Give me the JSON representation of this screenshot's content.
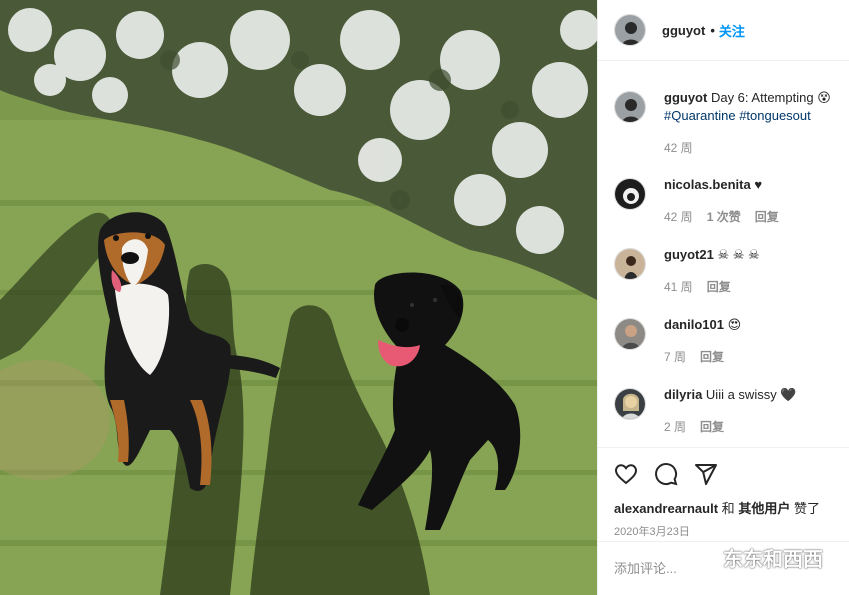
{
  "post": {
    "username": "gguyot",
    "follow_label": "关注",
    "separator": "•"
  },
  "caption": {
    "username": "gguyot",
    "text": "Day 6: Attempting",
    "emoji": "😵",
    "tags": [
      "#Quarantine",
      "#tonguesout"
    ],
    "age": "42 周"
  },
  "comments": [
    {
      "username": "nicolas.benita",
      "text": "♥",
      "age": "42 周",
      "likes": "1 次赞",
      "reply": "回复"
    },
    {
      "username": "guyot21",
      "text": "☠ ☠ ☠",
      "age": "41 周",
      "reply": "回复"
    },
    {
      "username": "danilo101",
      "text": "😍",
      "age": "7 周",
      "reply": "回复"
    },
    {
      "username": "dilyria",
      "text": "Uiii a swissy",
      "emoji": "🖤",
      "age": "2 周",
      "reply": "回复"
    }
  ],
  "actions": {
    "icons": [
      "heart-icon",
      "comment-icon",
      "share-icon"
    ],
    "likes_user": "alexandrearnault",
    "likes_and": "和",
    "likes_others": "其他用户",
    "likes_suffix": "赞了",
    "date": "2020年3月23日"
  },
  "add_comment": {
    "placeholder": "添加评论..."
  },
  "watermark": {
    "text": "东东和西西"
  },
  "colors": {
    "link": "#0095f6",
    "hashtag": "#00376b",
    "muted": "#8e8e8e"
  }
}
